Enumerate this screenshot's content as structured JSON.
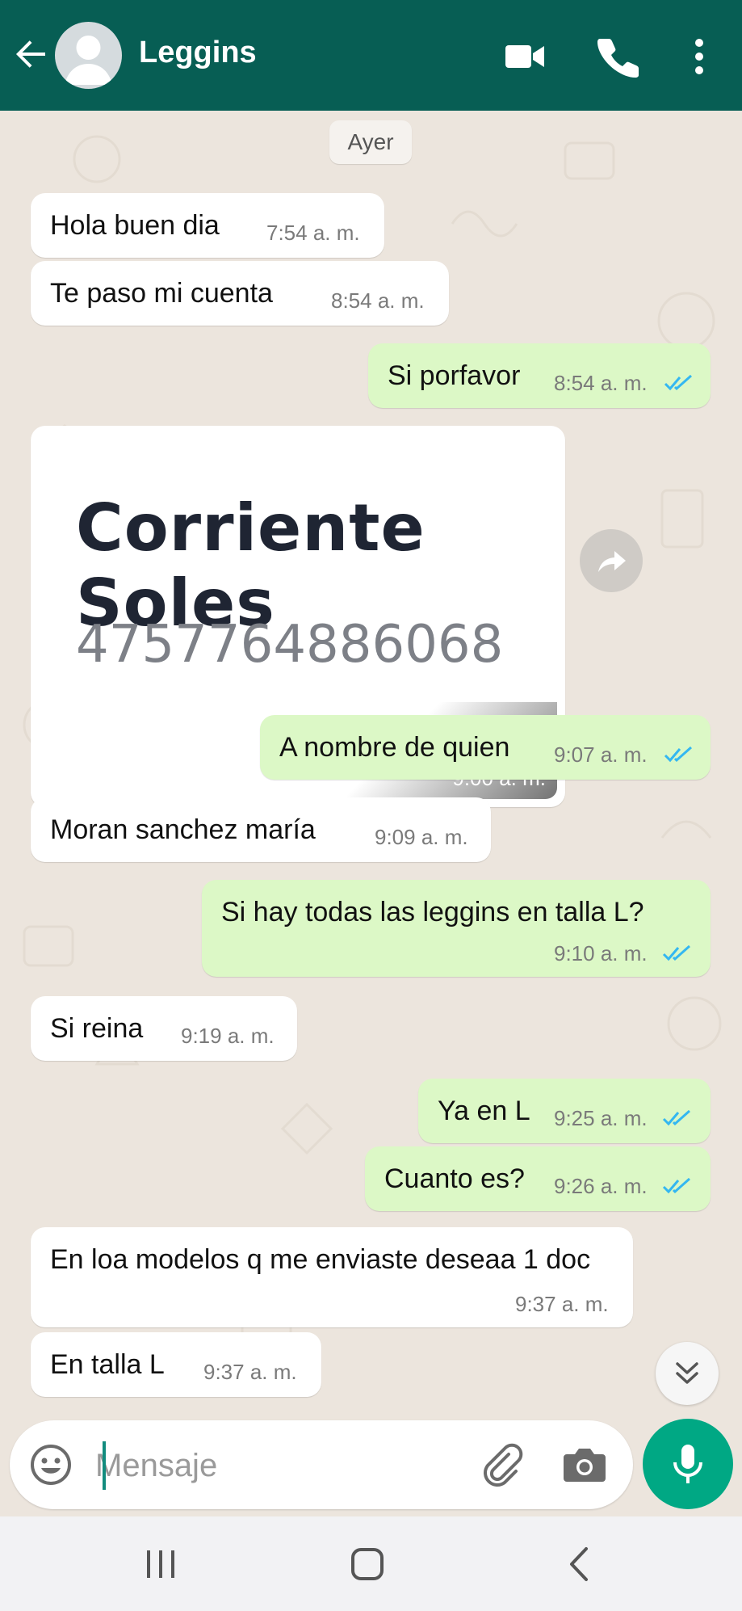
{
  "header": {
    "contact_name": "Leggins"
  },
  "chat": {
    "day_label": "Ayer",
    "messages": [
      {
        "dir": "in",
        "text": "Hola buen dia",
        "time": "7:54 a. m."
      },
      {
        "dir": "in",
        "text": "Te paso mi cuenta",
        "time": "8:54 a. m."
      },
      {
        "dir": "out",
        "text": "Si porfavor",
        "time": "8:54 a. m."
      },
      {
        "dir": "in",
        "type": "image",
        "image_title": "Corriente Soles",
        "image_number": "4757764886068",
        "time": "9:00 a. m."
      },
      {
        "dir": "out",
        "text": "A nombre de quien",
        "time": "9:07 a. m."
      },
      {
        "dir": "in",
        "text": "Moran sanchez maría",
        "time": "9:09 a. m."
      },
      {
        "dir": "out",
        "text": "Si hay todas las leggins en talla L?",
        "time": "9:10 a. m."
      },
      {
        "dir": "in",
        "text": "Si reina",
        "time": "9:19 a. m."
      },
      {
        "dir": "out",
        "text": "Ya en L",
        "time": "9:25 a. m."
      },
      {
        "dir": "out",
        "text": "Cuanto es?",
        "time": "9:26 a. m."
      },
      {
        "dir": "in",
        "text": "En loa modelos q me enviaste deseaa 1 doc",
        "time": "9:37 a. m."
      },
      {
        "dir": "in",
        "text": "En talla L",
        "time": "9:37 a. m."
      }
    ]
  },
  "input": {
    "placeholder": "Mensaje"
  },
  "colors": {
    "header": "#075e54",
    "outgoing_bubble": "#dcf8c6",
    "incoming_bubble": "#ffffff",
    "read_ticks": "#34b7f1",
    "mic_button": "#00a884"
  },
  "icons": [
    "back-arrow-icon",
    "avatar-icon",
    "video-call-icon",
    "phone-icon",
    "more-options-icon",
    "forward-icon",
    "scroll-down-icon",
    "emoji-icon",
    "attach-icon",
    "camera-icon",
    "mic-icon",
    "recents-icon",
    "home-icon",
    "nav-back-icon"
  ]
}
